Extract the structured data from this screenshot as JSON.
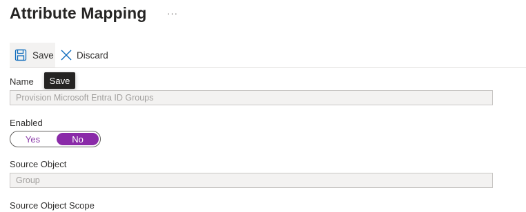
{
  "header": {
    "title": "Attribute Mapping",
    "more_label": "···"
  },
  "toolbar": {
    "save_label": "Save",
    "discard_label": "Discard"
  },
  "tooltip": {
    "text": "Save"
  },
  "form": {
    "name": {
      "label": "Name",
      "value": "Provision Microsoft Entra ID Groups"
    },
    "enabled": {
      "label": "Enabled",
      "options": [
        "Yes",
        "No"
      ],
      "selected": "No"
    },
    "source_object": {
      "label": "Source Object",
      "value": "Group"
    },
    "source_object_scope": {
      "label": "Source Object Scope"
    }
  },
  "colors": {
    "accent": "#8a2aa8",
    "toolbar_hover": "#f3f2f1",
    "field_bg": "#f3f2f1",
    "icon_blue": "#0f6cbd"
  },
  "icons": {
    "save": "floppy-disk-icon",
    "discard": "close-icon"
  }
}
